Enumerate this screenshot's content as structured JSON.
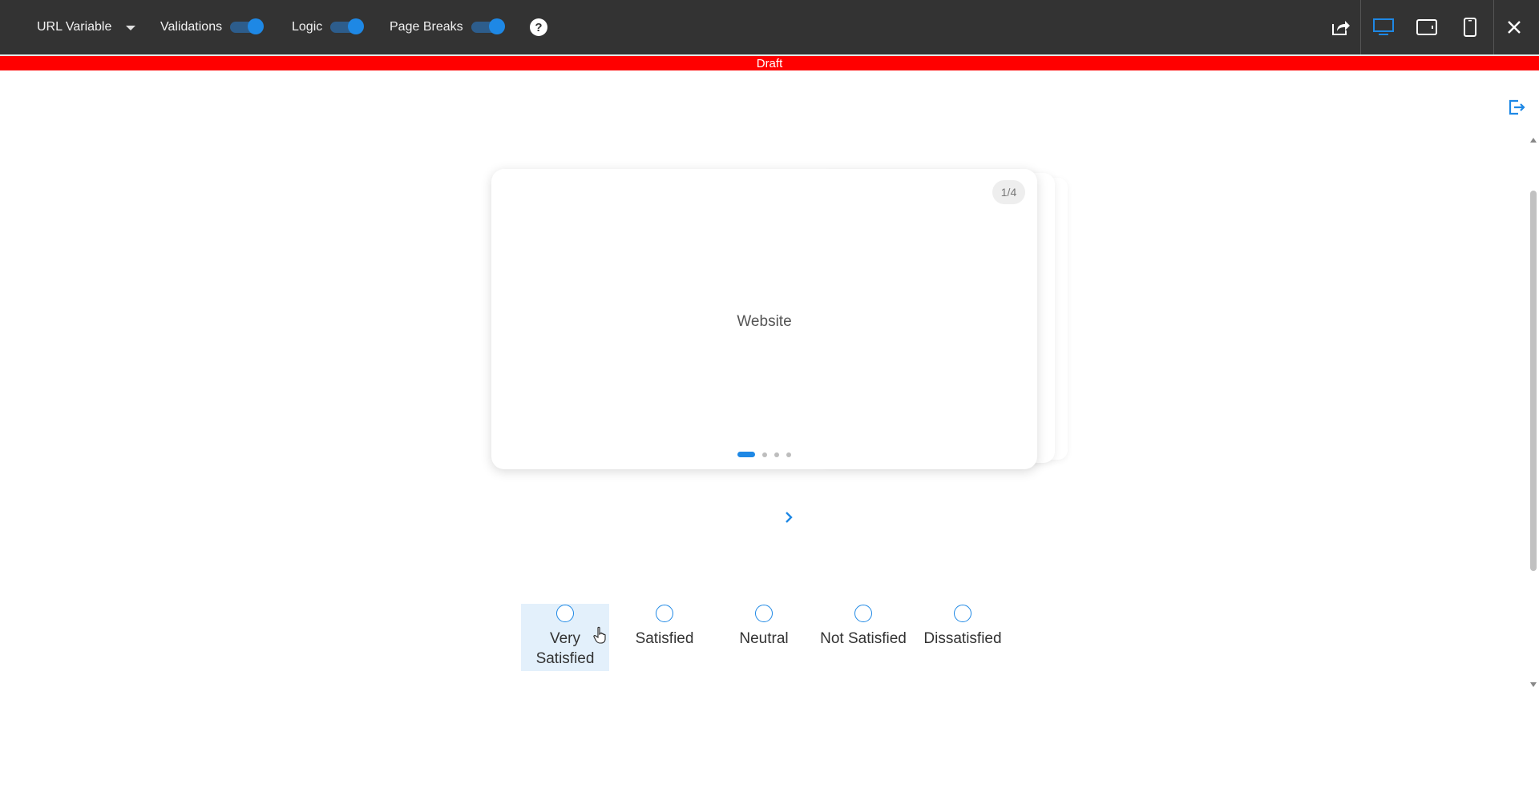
{
  "toolbar": {
    "url_variable_label": "URL Variable",
    "validations_label": "Validations",
    "logic_label": "Logic",
    "page_breaks_label": "Page Breaks",
    "help_label": "?",
    "toggles": {
      "validations": true,
      "logic": true,
      "page_breaks": true
    },
    "right_icons": [
      "share-icon",
      "desktop-icon",
      "tablet-icon",
      "mobile-icon",
      "close-icon"
    ],
    "active_view": "desktop"
  },
  "banner": {
    "label": "Draft",
    "color": "#ff0000"
  },
  "card": {
    "counter": "1/4",
    "title": "Website",
    "page_count": 4,
    "active_page": 1
  },
  "rating": {
    "options": [
      {
        "label": "Very Satisfied",
        "highlighted": true
      },
      {
        "label": "Satisfied",
        "highlighted": false
      },
      {
        "label": "Neutral",
        "highlighted": false
      },
      {
        "label": "Not Satisfied",
        "highlighted": false
      },
      {
        "label": "Dissatisfied",
        "highlighted": false
      }
    ]
  },
  "colors": {
    "accent": "#1e88e5",
    "toolbar": "#333333",
    "highlight": "#e3f0fb"
  }
}
